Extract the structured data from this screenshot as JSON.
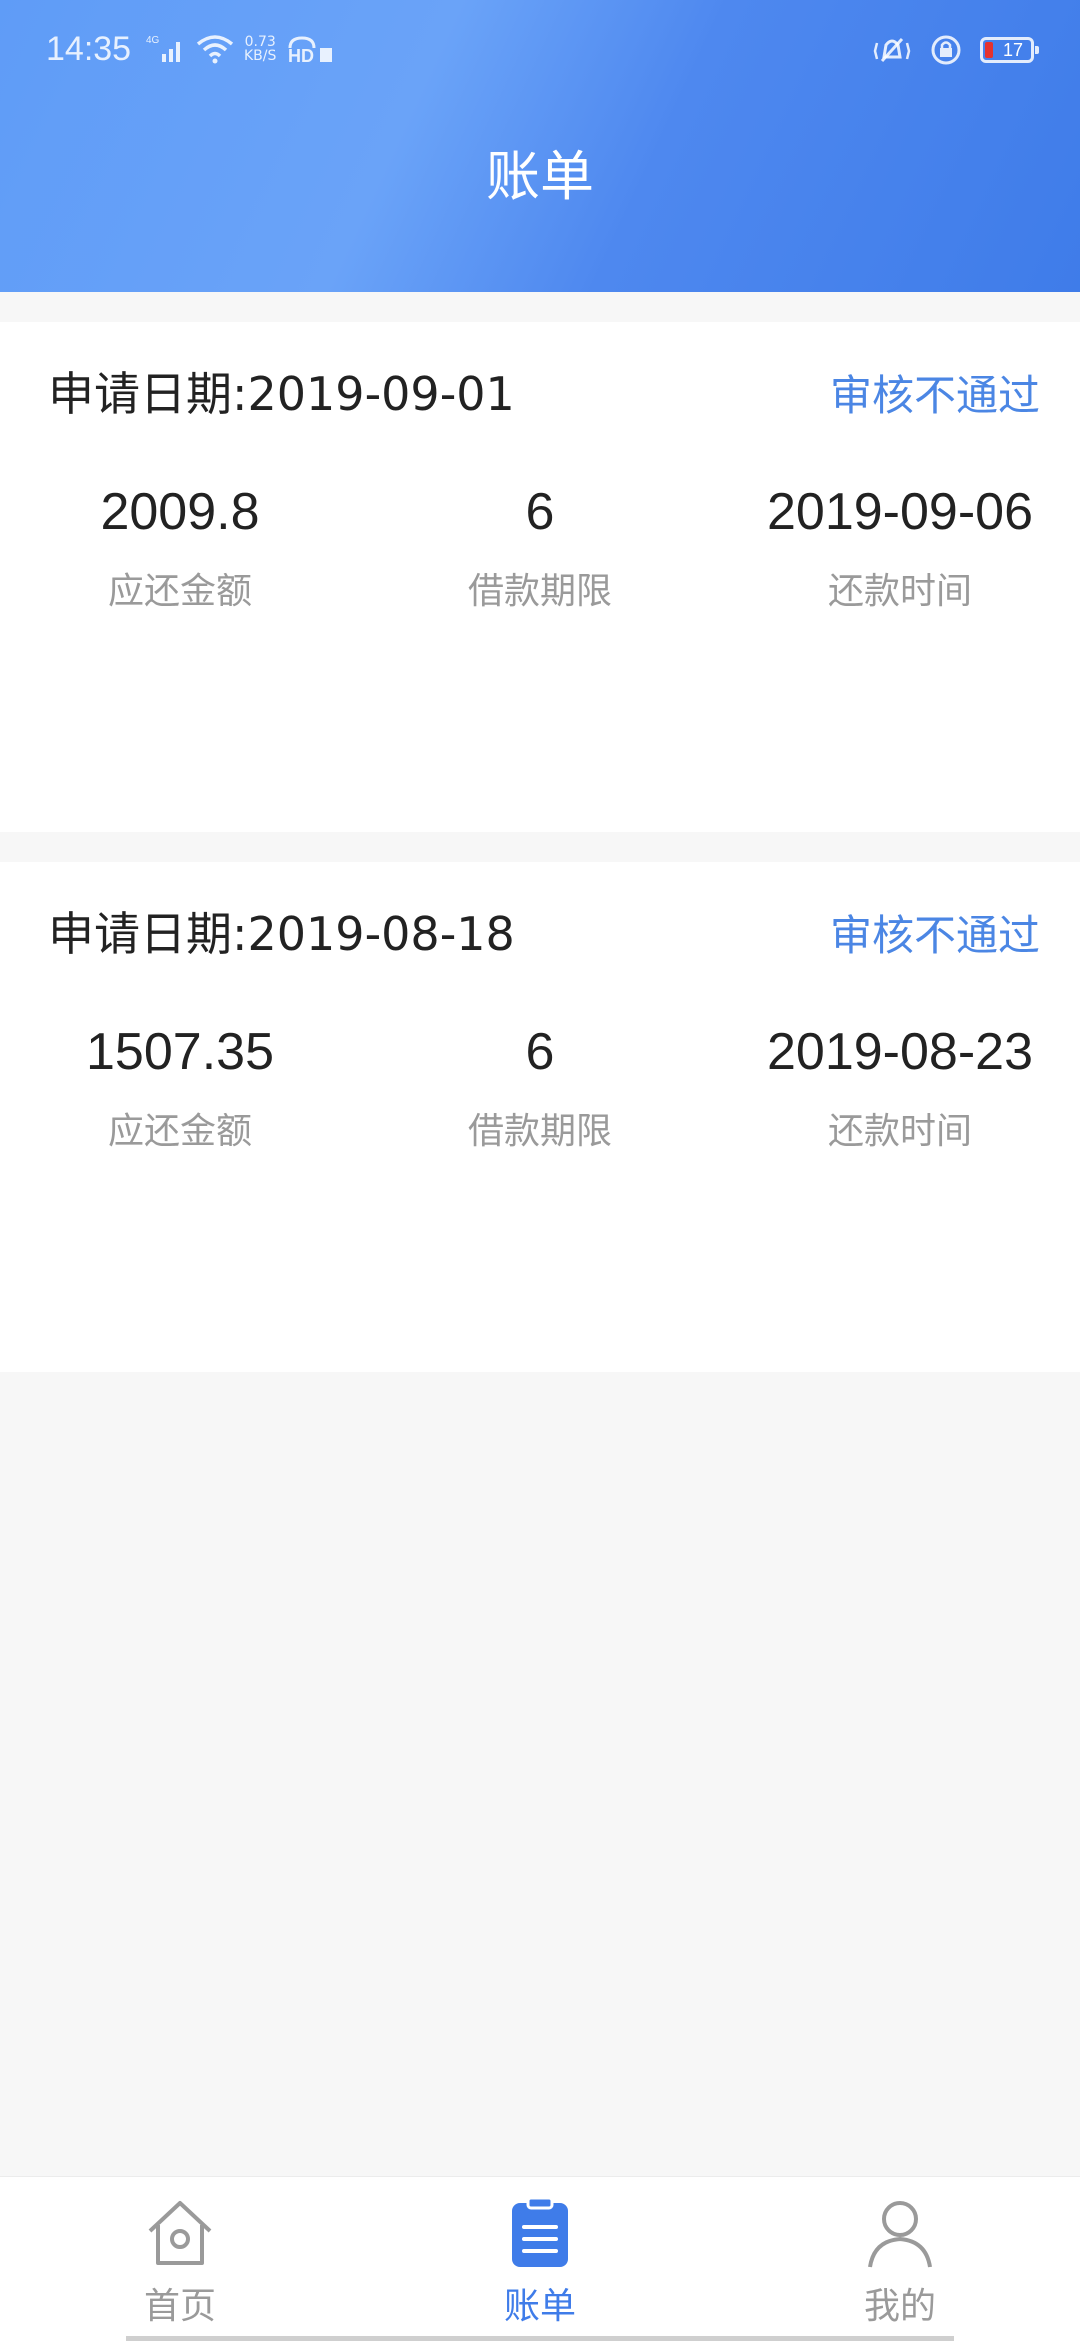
{
  "status_bar": {
    "time": "14:35",
    "network": "4G",
    "speed_value": "0.73",
    "speed_unit": "KB/S",
    "hd": "HD",
    "battery": "17"
  },
  "header": {
    "title": "账单"
  },
  "bills": [
    {
      "apply_date": "申请日期:2019-09-01",
      "status": "审核不通过",
      "amount": "2009.8",
      "amount_label": "应还金额",
      "term": "6",
      "term_label": "借款期限",
      "repay_date": "2019-09-06",
      "repay_label": "还款时间"
    },
    {
      "apply_date": "申请日期:2019-08-18",
      "status": "审核不通过",
      "amount": "1507.35",
      "amount_label": "应还金额",
      "term": "6",
      "term_label": "借款期限",
      "repay_date": "2019-08-23",
      "repay_label": "还款时间"
    }
  ],
  "nav": {
    "items": [
      {
        "label": "首页",
        "icon": "home-icon",
        "active": false
      },
      {
        "label": "账单",
        "icon": "bill-icon",
        "active": true
      },
      {
        "label": "我的",
        "icon": "user-icon",
        "active": false
      }
    ]
  },
  "colors": {
    "accent": "#3f7ce9",
    "status_text": "#4b86e4",
    "header_gradient": "#5f9cf7"
  }
}
